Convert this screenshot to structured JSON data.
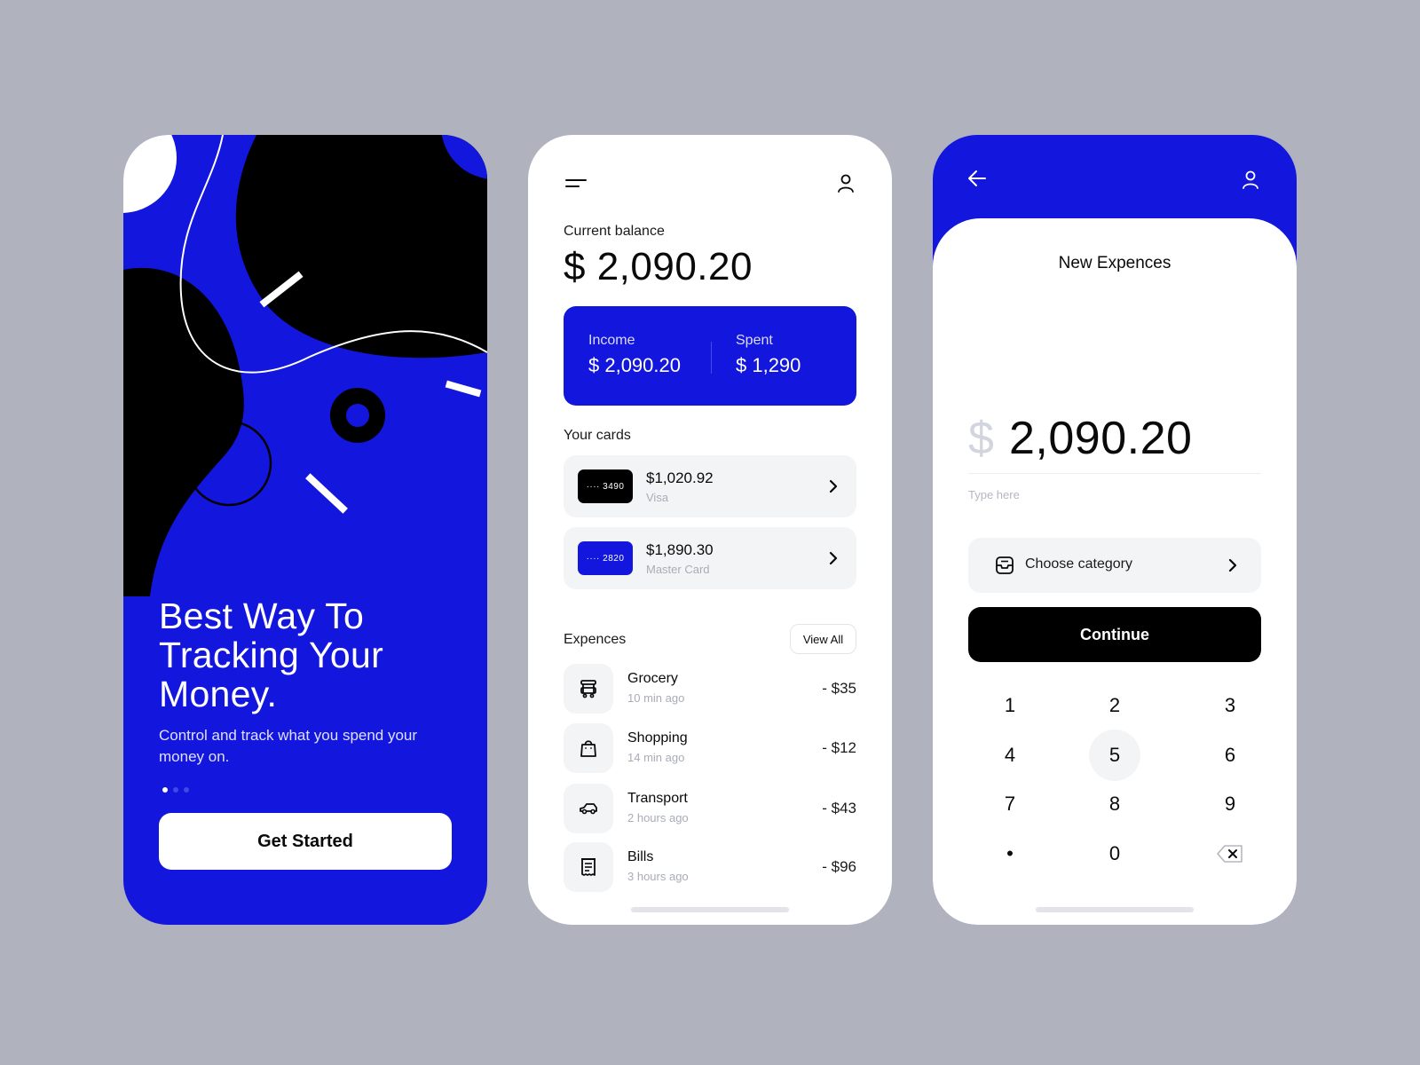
{
  "colors": {
    "brand_blue": "#1316dd",
    "background": "#b0b2bd",
    "surface_gray": "#f3f4f6",
    "muted_text": "#a9acb8"
  },
  "onboarding": {
    "title": "Best Way To Tracking Your Money.",
    "subtitle": "Control and track what you spend your money on.",
    "pagination": {
      "total": 3,
      "active": 1
    },
    "cta_label": "Get Started"
  },
  "dashboard": {
    "menu_icon": "menu-icon",
    "profile_icon": "user-icon",
    "balance_label": "Current balance",
    "balance_value": "$ 2,090.20",
    "income_label": "Income",
    "income_value": "$ 2,090.20",
    "spent_label": "Spent",
    "spent_value": "$ 1,290",
    "cards_label": "Your cards",
    "cards": [
      {
        "masked": "···· 3490",
        "amount": "$1,020.92",
        "type": "Visa",
        "chip_color": "#000000"
      },
      {
        "masked": "···· 2820",
        "amount": "$1,890.30",
        "type": "Master Card",
        "chip_color": "#1316dd"
      }
    ],
    "expenses_label": "Expences",
    "view_all_label": "View All",
    "expenses": [
      {
        "icon": "grocery-cart-icon",
        "name": "Grocery",
        "time": "10 min ago",
        "amount": "- $35"
      },
      {
        "icon": "shopping-bag-icon",
        "name": "Shopping",
        "time": "14 min ago",
        "amount": "- $12"
      },
      {
        "icon": "car-icon",
        "name": "Transport",
        "time": "2 hours ago",
        "amount": "- $43"
      },
      {
        "icon": "receipt-icon",
        "name": "Bills",
        "time": "3 hours ago",
        "amount": "- $96"
      }
    ]
  },
  "new_expense": {
    "back_icon": "arrow-left-icon",
    "profile_icon": "user-icon",
    "title": "New Expences",
    "currency_symbol": "$",
    "amount": "2,090.20",
    "note_placeholder": "Type here",
    "category_label": "Choose category",
    "continue_label": "Continue",
    "keypad": [
      "1",
      "2",
      "3",
      "4",
      "5",
      "6",
      "7",
      "8",
      "9",
      "•",
      "0",
      "backspace"
    ],
    "pressed_key": "5"
  }
}
